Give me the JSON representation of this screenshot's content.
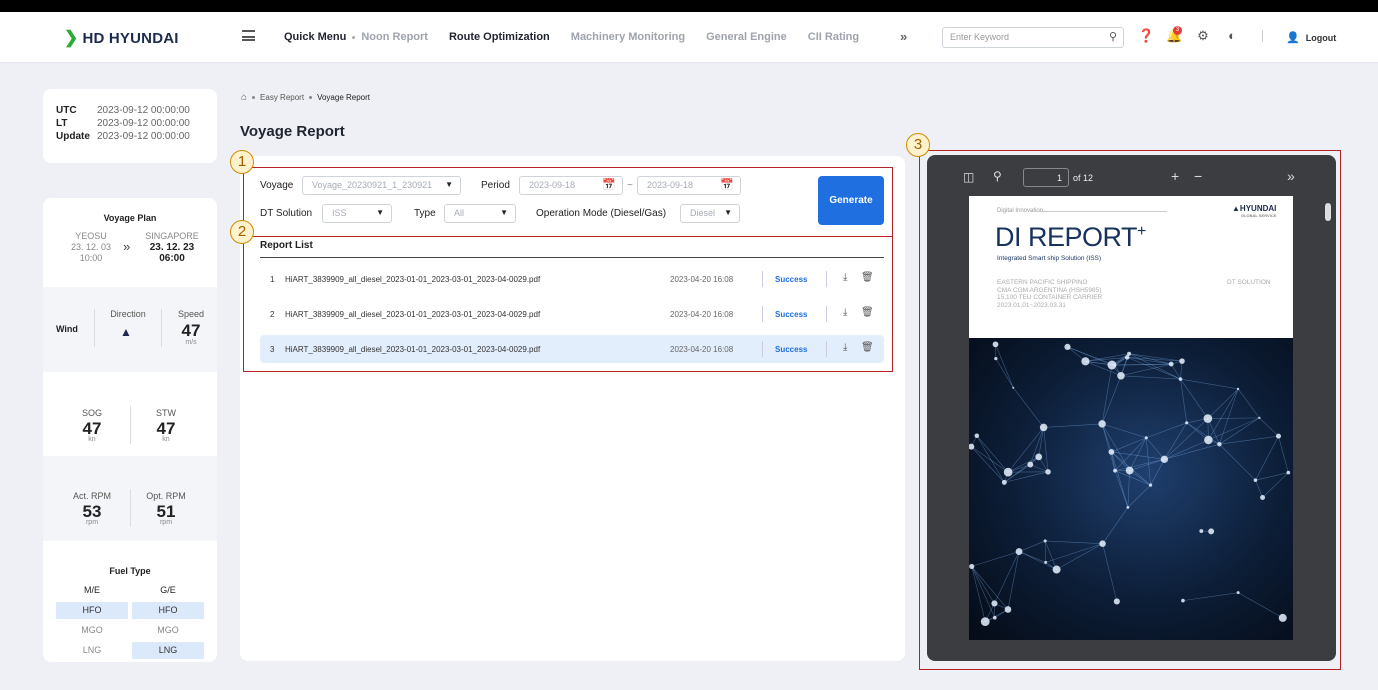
{
  "header": {
    "brand": "HD HYUNDAI",
    "nav": [
      "Quick Menu",
      "Noon Report",
      "Route Optimization",
      "Machinery Monitoring",
      "General Engine",
      "CII Rating"
    ],
    "search_placeholder": "Enter Keyword",
    "notif_count": "3",
    "logout": "Logout"
  },
  "time": {
    "utc_label": "UTC",
    "utc": "2023-09-12 00:00:00",
    "lt_label": "LT",
    "lt": "2023-09-12 00:00:00",
    "update_label": "Update",
    "update": "2023-09-12 00:00:00"
  },
  "voyage_plan": {
    "title": "Voyage Plan",
    "from_port": "YEOSU",
    "from_date": "23. 12. 03",
    "from_time": "10:00",
    "to_port": "SINGAPORE",
    "to_date": "23. 12. 23",
    "to_time": "06:00"
  },
  "wind": {
    "label": "Wind",
    "direction_label": "Direction",
    "speed_label": "Speed",
    "speed": "47",
    "speed_unit": "m/s"
  },
  "sog": {
    "label": "SOG",
    "value": "47",
    "unit": "kn"
  },
  "stw": {
    "label": "STW",
    "value": "47",
    "unit": "kn"
  },
  "act_rpm": {
    "label": "Act. RPM",
    "value": "53",
    "unit": "rpm"
  },
  "opt_rpm": {
    "label": "Opt. RPM",
    "value": "51",
    "unit": "rpm"
  },
  "fuel": {
    "title": "Fuel Type",
    "me_label": "M/E",
    "ge_label": "G/E",
    "me": [
      "HFO",
      "MGO",
      "LNG"
    ],
    "ge": [
      "HFO",
      "MGO",
      "LNG"
    ]
  },
  "breadcrumb": [
    "Easy Report",
    "Voyage Report"
  ],
  "page_title": "Voyage Report",
  "form": {
    "voyage_label": "Voyage",
    "voyage_value": "Voyage_20230921_1_230921",
    "period_label": "Period",
    "period_from": "2023-09-18",
    "period_to": "2023-09-18",
    "period_sep": "~",
    "dt_label": "DT Solution",
    "dt_value": "ISS",
    "type_label": "Type",
    "type_value": "All",
    "mode_label": "Operation Mode (Diesel/Gas)",
    "mode_value": "Diesel",
    "generate": "Generate"
  },
  "report_list": {
    "title": "Report List",
    "rows": [
      {
        "n": "1",
        "file": "HiART_3839909_all_diesel_2023-01-01_2023-03-01_2023-04-0029.pdf",
        "date": "2023-04-20 16:08",
        "status": "Success"
      },
      {
        "n": "2",
        "file": "HiART_3839909_all_diesel_2023-01-01_2023-03-01_2023-04-0029.pdf",
        "date": "2023-04-20 16:08",
        "status": "Success"
      },
      {
        "n": "3",
        "file": "HiART_3839909_all_diesel_2023-01-01_2023-03-01_2023-04-0029.pdf",
        "date": "2023-04-20 16:08",
        "status": "Success"
      }
    ]
  },
  "viewer": {
    "page": "1",
    "of": "of 12"
  },
  "doc": {
    "kicker": "Digital Innovation",
    "logo": "HYUNDAI",
    "logo_sub": "GLOBAL SERVICE",
    "title": "DI REPORT",
    "title_sup": "+",
    "subtitle": "Integrated Smart ship Solution (ISS)",
    "meta1": "EASTERN PACIFIC SHIPPING",
    "meta2": "CMA CGM ARGENTINA (HSH5985)",
    "meta3": "15,100 TEU CONTAINER CARRIER",
    "meta4": "2023.01.01~2023.03.31",
    "solution": "DT SOLUTION"
  },
  "annotations": [
    "1",
    "2",
    "3"
  ],
  "colors": {
    "accent": "#1f6fe0",
    "highlight": "#b32025",
    "brand_green": "#2eaa39"
  }
}
